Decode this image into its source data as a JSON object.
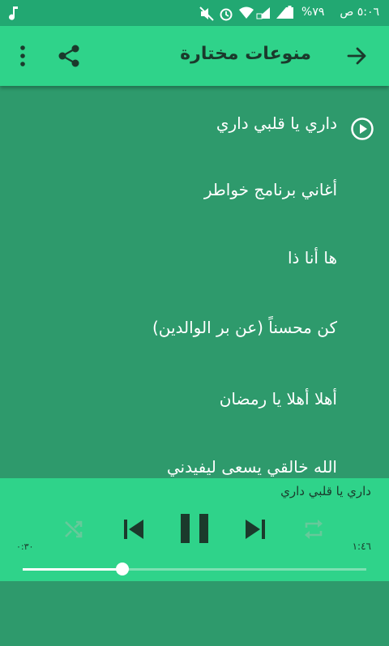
{
  "status_bar": {
    "time": "٥:٠٦ ص",
    "battery": "%٧٩"
  },
  "app_bar": {
    "title": "منوعات مختارة",
    "back_icon": "arrow-forward-icon",
    "share_icon": "share-icon",
    "menu_icon": "more-vert-icon"
  },
  "playlist": {
    "items": [
      {
        "label": "داري يا قلبي داري",
        "playing": true
      },
      {
        "label": "أغاني برنامج خواطر"
      },
      {
        "label": "ها أنا ذا"
      },
      {
        "label": "كن محسناً (عن بر الوالدين)"
      },
      {
        "label": "أهلا أهلا يا رمضان"
      },
      {
        "label": "الله خالقي يسعى ليفيدني"
      }
    ]
  },
  "player": {
    "now_playing": "داري يا قلبي داري",
    "elapsed": "٠:٣٠",
    "duration": "١:٤٦",
    "progress": 0.29,
    "controls": {
      "shuffle": "shuffle-icon",
      "previous": "skip-previous-icon",
      "pause": "pause-icon",
      "next": "skip-next-icon",
      "repeat": "repeat-icon"
    }
  },
  "colors": {
    "accent": "#2fd38a",
    "background": "#2e9a6c",
    "status_bar": "#22a872",
    "dark_text": "#1b3a2c"
  }
}
